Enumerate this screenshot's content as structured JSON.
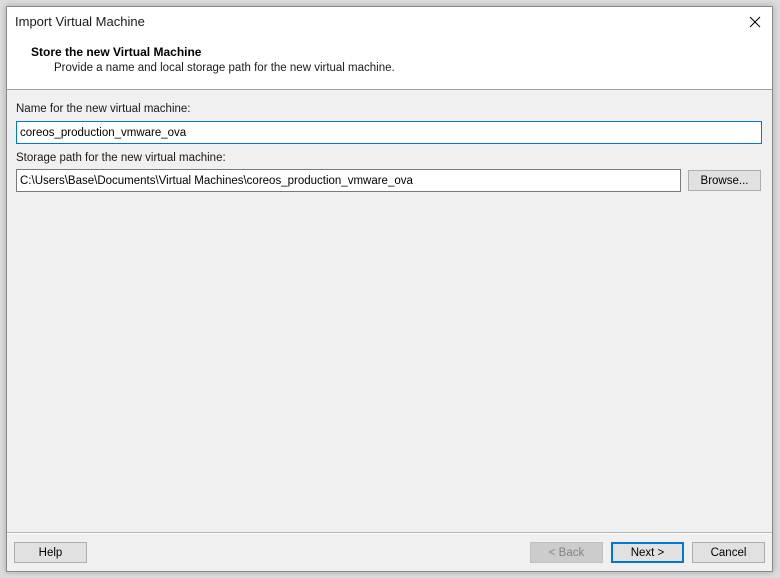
{
  "window": {
    "title": "Import Virtual Machine"
  },
  "header": {
    "heading": "Store the new Virtual Machine",
    "description": "Provide a name and local storage path for the new virtual machine."
  },
  "form": {
    "name_label": "Name for the new virtual machine:",
    "name_value": "coreos_production_vmware_ova",
    "path_label": "Storage path for the new virtual machine:",
    "path_value": "C:\\Users\\Base\\Documents\\Virtual Machines\\coreos_production_vmware_ova",
    "browse_label": "Browse..."
  },
  "footer": {
    "help_label": "Help",
    "back_label": "< Back",
    "next_label": "Next >",
    "cancel_label": "Cancel"
  },
  "colors": {
    "focus_accent": "#0078d7"
  },
  "icons": {
    "close": "close-icon"
  }
}
